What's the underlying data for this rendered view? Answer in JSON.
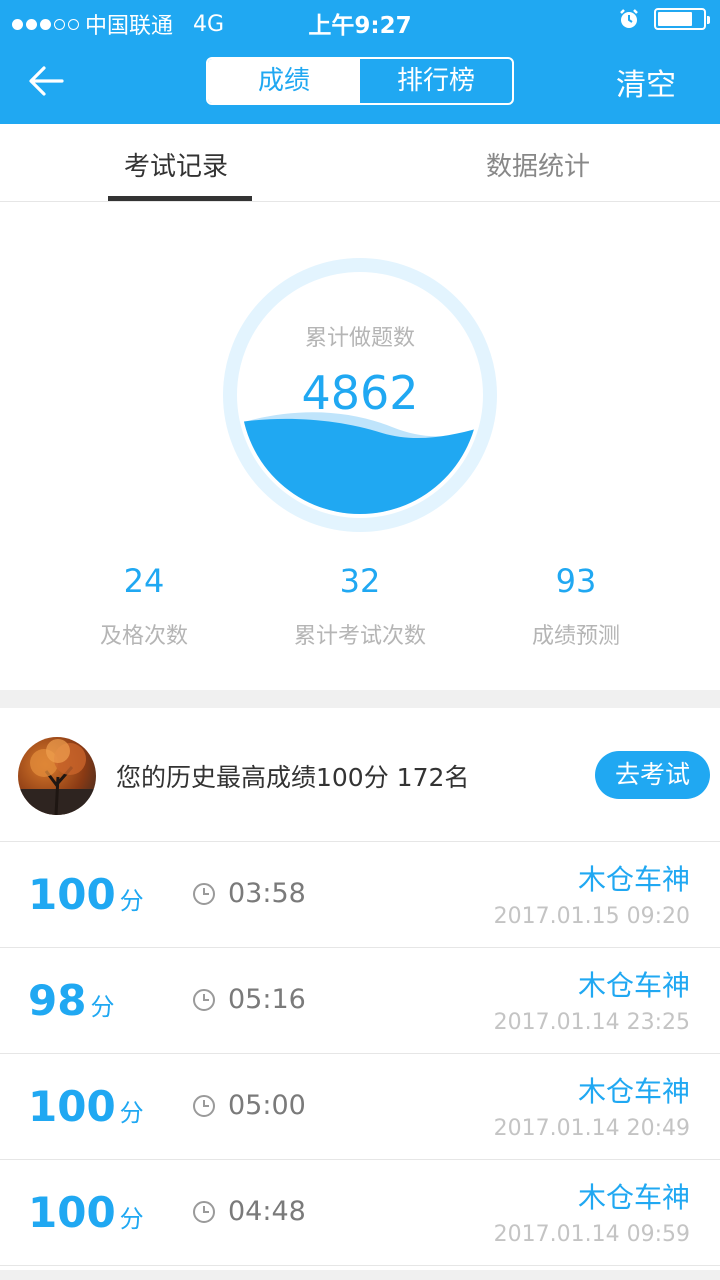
{
  "status_bar": {
    "carrier": "中国联通",
    "network": "4G",
    "time": "上午9:27"
  },
  "nav": {
    "segments": [
      "成绩",
      "排行榜"
    ],
    "active_segment": 0,
    "clear_label": "清空"
  },
  "tabs": {
    "items": [
      "考试记录",
      "数据统计"
    ],
    "active": 0
  },
  "gauge": {
    "label": "累计做题数",
    "value": "4862"
  },
  "stats": [
    {
      "value": "24",
      "label": "及格次数"
    },
    {
      "value": "32",
      "label": "累计考试次数"
    },
    {
      "value": "93",
      "label": "成绩预测"
    }
  ],
  "best": {
    "text": "您的历史最高成绩100分  172名",
    "button_label": "去考试"
  },
  "records": [
    {
      "score": "100",
      "unit": "分",
      "duration": "03:58",
      "name": "木仓车神",
      "datetime": "2017.01.15 09:20"
    },
    {
      "score": "98",
      "unit": "分",
      "duration": "05:16",
      "name": "木仓车神",
      "datetime": "2017.01.14 23:25"
    },
    {
      "score": "100",
      "unit": "分",
      "duration": "05:00",
      "name": "木仓车神",
      "datetime": "2017.01.14 20:49"
    },
    {
      "score": "100",
      "unit": "分",
      "duration": "04:48",
      "name": "木仓车神",
      "datetime": "2017.01.14 09:59"
    }
  ],
  "colors": {
    "accent": "#20a8f2",
    "muted_text": "#b5b5b5",
    "divider": "#e6e6e6"
  }
}
